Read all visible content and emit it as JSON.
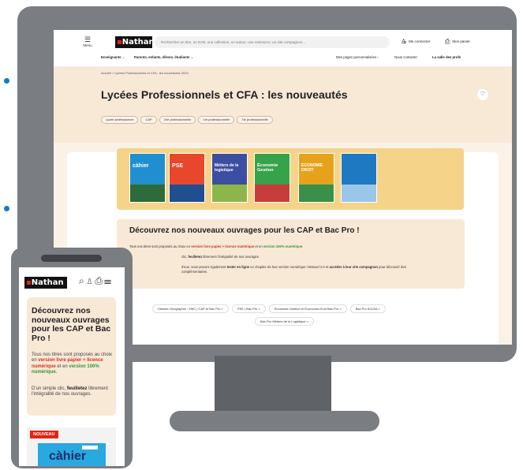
{
  "desktop": {
    "header": {
      "menu_label": "Menu",
      "logo": "Nathan",
      "search_placeholder": "Rechercher un titre, un EAN, une collection, un auteur, une ressource, un site compagnon…",
      "login": "Me connecter",
      "cart": "Mon panier",
      "nav": [
        {
          "label": "Enseignants"
        },
        {
          "label": "Parents, enfants, élèves, étudiants"
        }
      ],
      "my_pages": "Mes pages personnalisées",
      "contact": "Nous contacter",
      "salle": "La salle des profs"
    },
    "breadcrumb": "Accueil  >  Lycées Professionnels et CFA : les nouveautés 2023",
    "page_title": "Lycées Professionnels et CFA : les nouveautés",
    "chips": [
      "Lycée professionnel",
      "CAP",
      "2de professionnelle",
      "1re professionnelle",
      "Tle professionnelle"
    ],
    "books": [
      {
        "title": "càhier",
        "color": "#1f8fd0"
      },
      {
        "title": "PSE",
        "color": "#e8472b"
      },
      {
        "title": "Métiers de la logistique",
        "color": "#3b4ea0"
      },
      {
        "title": "Économie Gestion",
        "color": "#36a24a"
      },
      {
        "title": "ÉCONOMIE DROIT",
        "color": "#e7a21b"
      },
      {
        "title": "",
        "color": "#1e78c2"
      }
    ],
    "promo": {
      "title": "Découvrez nos nouveaux ouvrages pour les CAP et Bac Pro !",
      "line1_a": "Tous nos titres sont proposés au choix en ",
      "line1_b": "version livre papier + licence numérique",
      "line1_c": " et en ",
      "line1_d": "version 100% numérique",
      "line1_e": ".",
      "line2_a": "clic, ",
      "line2_b": "feuilletez",
      "line2_c": " librement l'intégralité de nos ouvrages.",
      "line3_a": "d'eux, vous pouvez également ",
      "line3_b": "tester en ligne",
      "line3_c": " un chapitre de leur version numérique i-Manuel 2.0 et ",
      "line3_d": "accéder à leur site compagnon",
      "line3_e": " pour découvrir des",
      "line4": "complémentaires."
    },
    "links": [
      "Histoire-Géographie - EMC | CAP et Bac Pro  >",
      "PSE | Bac Pro  >",
      "Économie-Gestion et Économie-Droit Bac Pro  >",
      "Bac Pro AGOrA  >",
      "Bac Pro Métiers de la Logistique  >"
    ]
  },
  "mobile": {
    "logo": "Nathan",
    "title": "Découvrez nos nouveaux ouvrages pour les CAP et Bac Pro !",
    "p1_a": "Tous nos titres sont proposés au choix en ",
    "p1_b": "version livre papier + licence numérique",
    "p1_c": " et en ",
    "p1_d": "version 100% numérique",
    "p1_e": ".",
    "p2_a": "D'un simple clic, ",
    "p2_b": "feuilletez",
    "p2_c": " librement l'intégralité de nos ouvrages.",
    "badge": "NOUVEAU",
    "book_title": "càhier"
  },
  "colors": {
    "brand_red": "#e42313",
    "accent_blue": "#1778c9",
    "banner_bg": "#f8e8d6",
    "link_red": "#d1311b",
    "link_green": "#2a9a3a"
  }
}
